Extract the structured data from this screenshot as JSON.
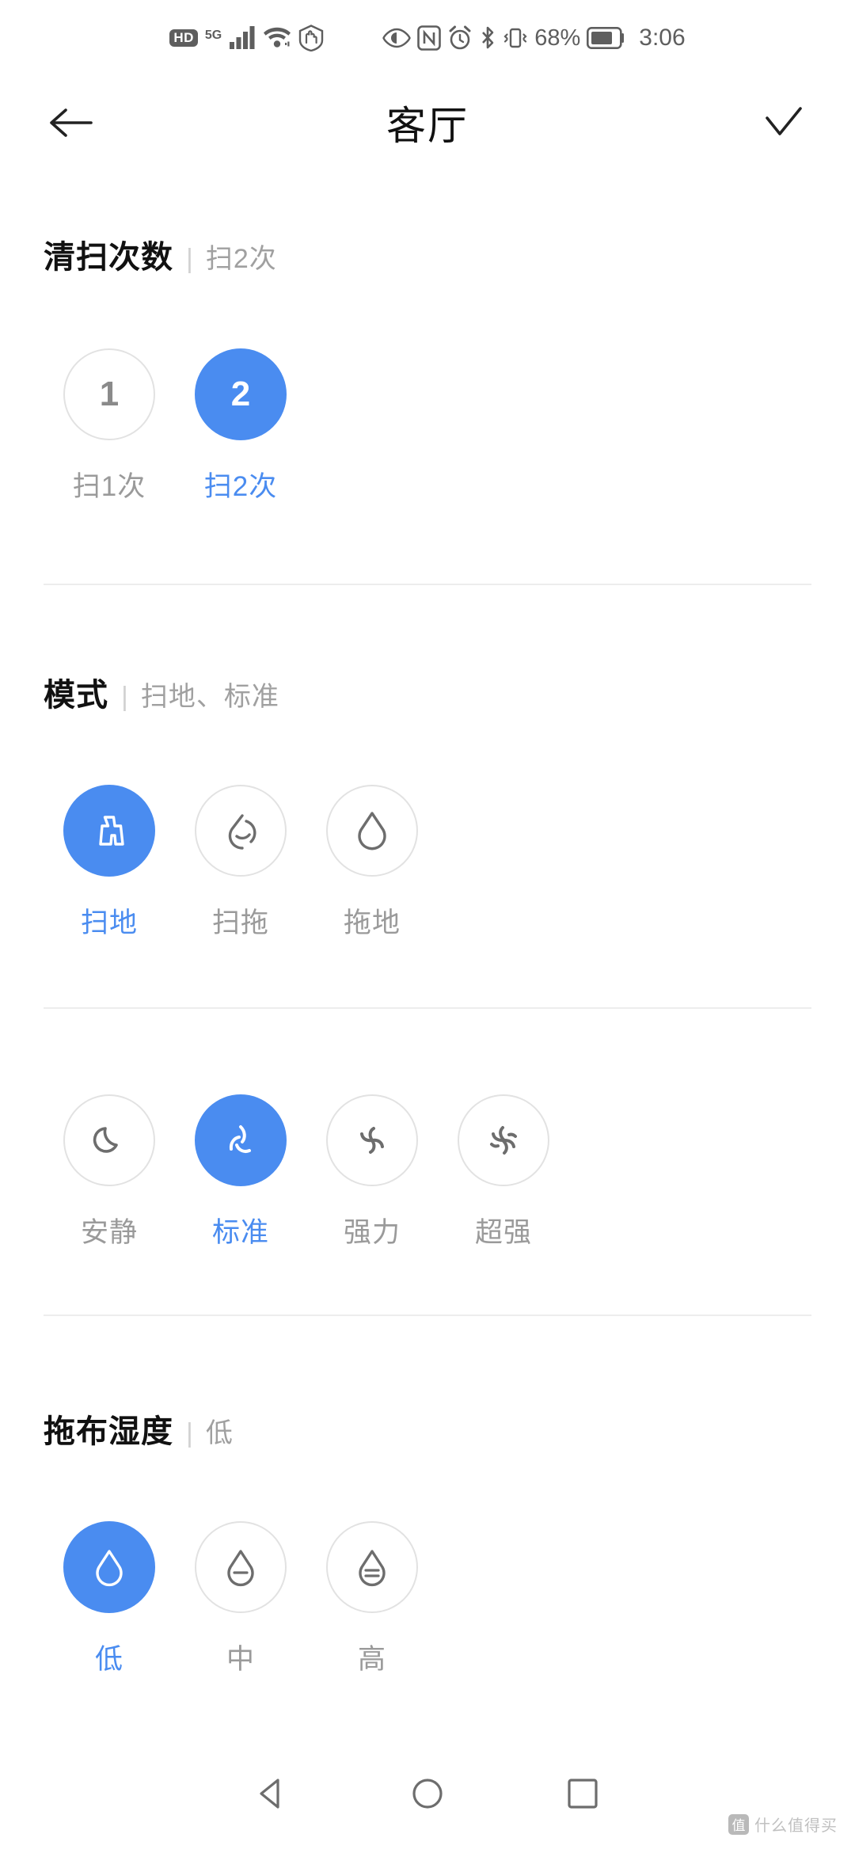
{
  "statusbar": {
    "hd_label": "HD",
    "network_label": "5G",
    "battery_percent": "68%",
    "time": "3:06",
    "left_icons": [
      "hd-icon",
      "5g-icon",
      "signal-bars-icon",
      "wifi-icon",
      "hand-shield-icon"
    ],
    "right_icons": [
      "eye-comfort-icon",
      "nfc-icon",
      "alarm-icon",
      "bluetooth-icon",
      "vibrate-icon",
      "battery-icon"
    ]
  },
  "header": {
    "back_icon": "arrow-left-icon",
    "title": "客厅",
    "confirm_icon": "check-icon"
  },
  "sections": [
    {
      "id": "clean-count",
      "title": "清扫次数",
      "separator": "|",
      "summary": "扫2次",
      "options": [
        {
          "glyph": "1",
          "label": "扫1次",
          "selected": false
        },
        {
          "glyph": "2",
          "label": "扫2次",
          "selected": true
        }
      ]
    },
    {
      "id": "mode",
      "title": "模式",
      "separator": "|",
      "summary": "扫地、标准",
      "options": [
        {
          "icon": "broom-icon",
          "label": "扫地",
          "selected": true
        },
        {
          "icon": "sweep-mop-icon",
          "label": "扫拖",
          "selected": false
        },
        {
          "icon": "water-drop-icon",
          "label": "拖地",
          "selected": false
        }
      ]
    },
    {
      "id": "suction",
      "title": "",
      "separator": "",
      "summary": "",
      "options": [
        {
          "icon": "moon-icon",
          "label": "安静",
          "selected": false
        },
        {
          "icon": "fan-2-blade-icon",
          "label": "标准",
          "selected": true
        },
        {
          "icon": "fan-3-blade-icon",
          "label": "强力",
          "selected": false
        },
        {
          "icon": "fan-4-blade-icon",
          "label": "超强",
          "selected": false
        }
      ]
    },
    {
      "id": "mop-humidity",
      "title": "拖布湿度",
      "separator": "|",
      "summary": "低",
      "options": [
        {
          "icon": "drop-level-low-icon",
          "label": "低",
          "selected": true
        },
        {
          "icon": "drop-level-mid-icon",
          "label": "中",
          "selected": false
        },
        {
          "icon": "drop-level-high-icon",
          "label": "高",
          "selected": false
        }
      ]
    }
  ],
  "navbar": {
    "back_icon": "nav-back-triangle-icon",
    "home_icon": "nav-home-circle-icon",
    "recents_icon": "nav-recents-square-icon"
  },
  "watermark": {
    "badge": "值",
    "text": "什么值得买"
  },
  "colors": {
    "accent": "#4a8cf0",
    "muted": "#9a9a9a",
    "border": "#e2e2e2",
    "title": "#111111"
  }
}
